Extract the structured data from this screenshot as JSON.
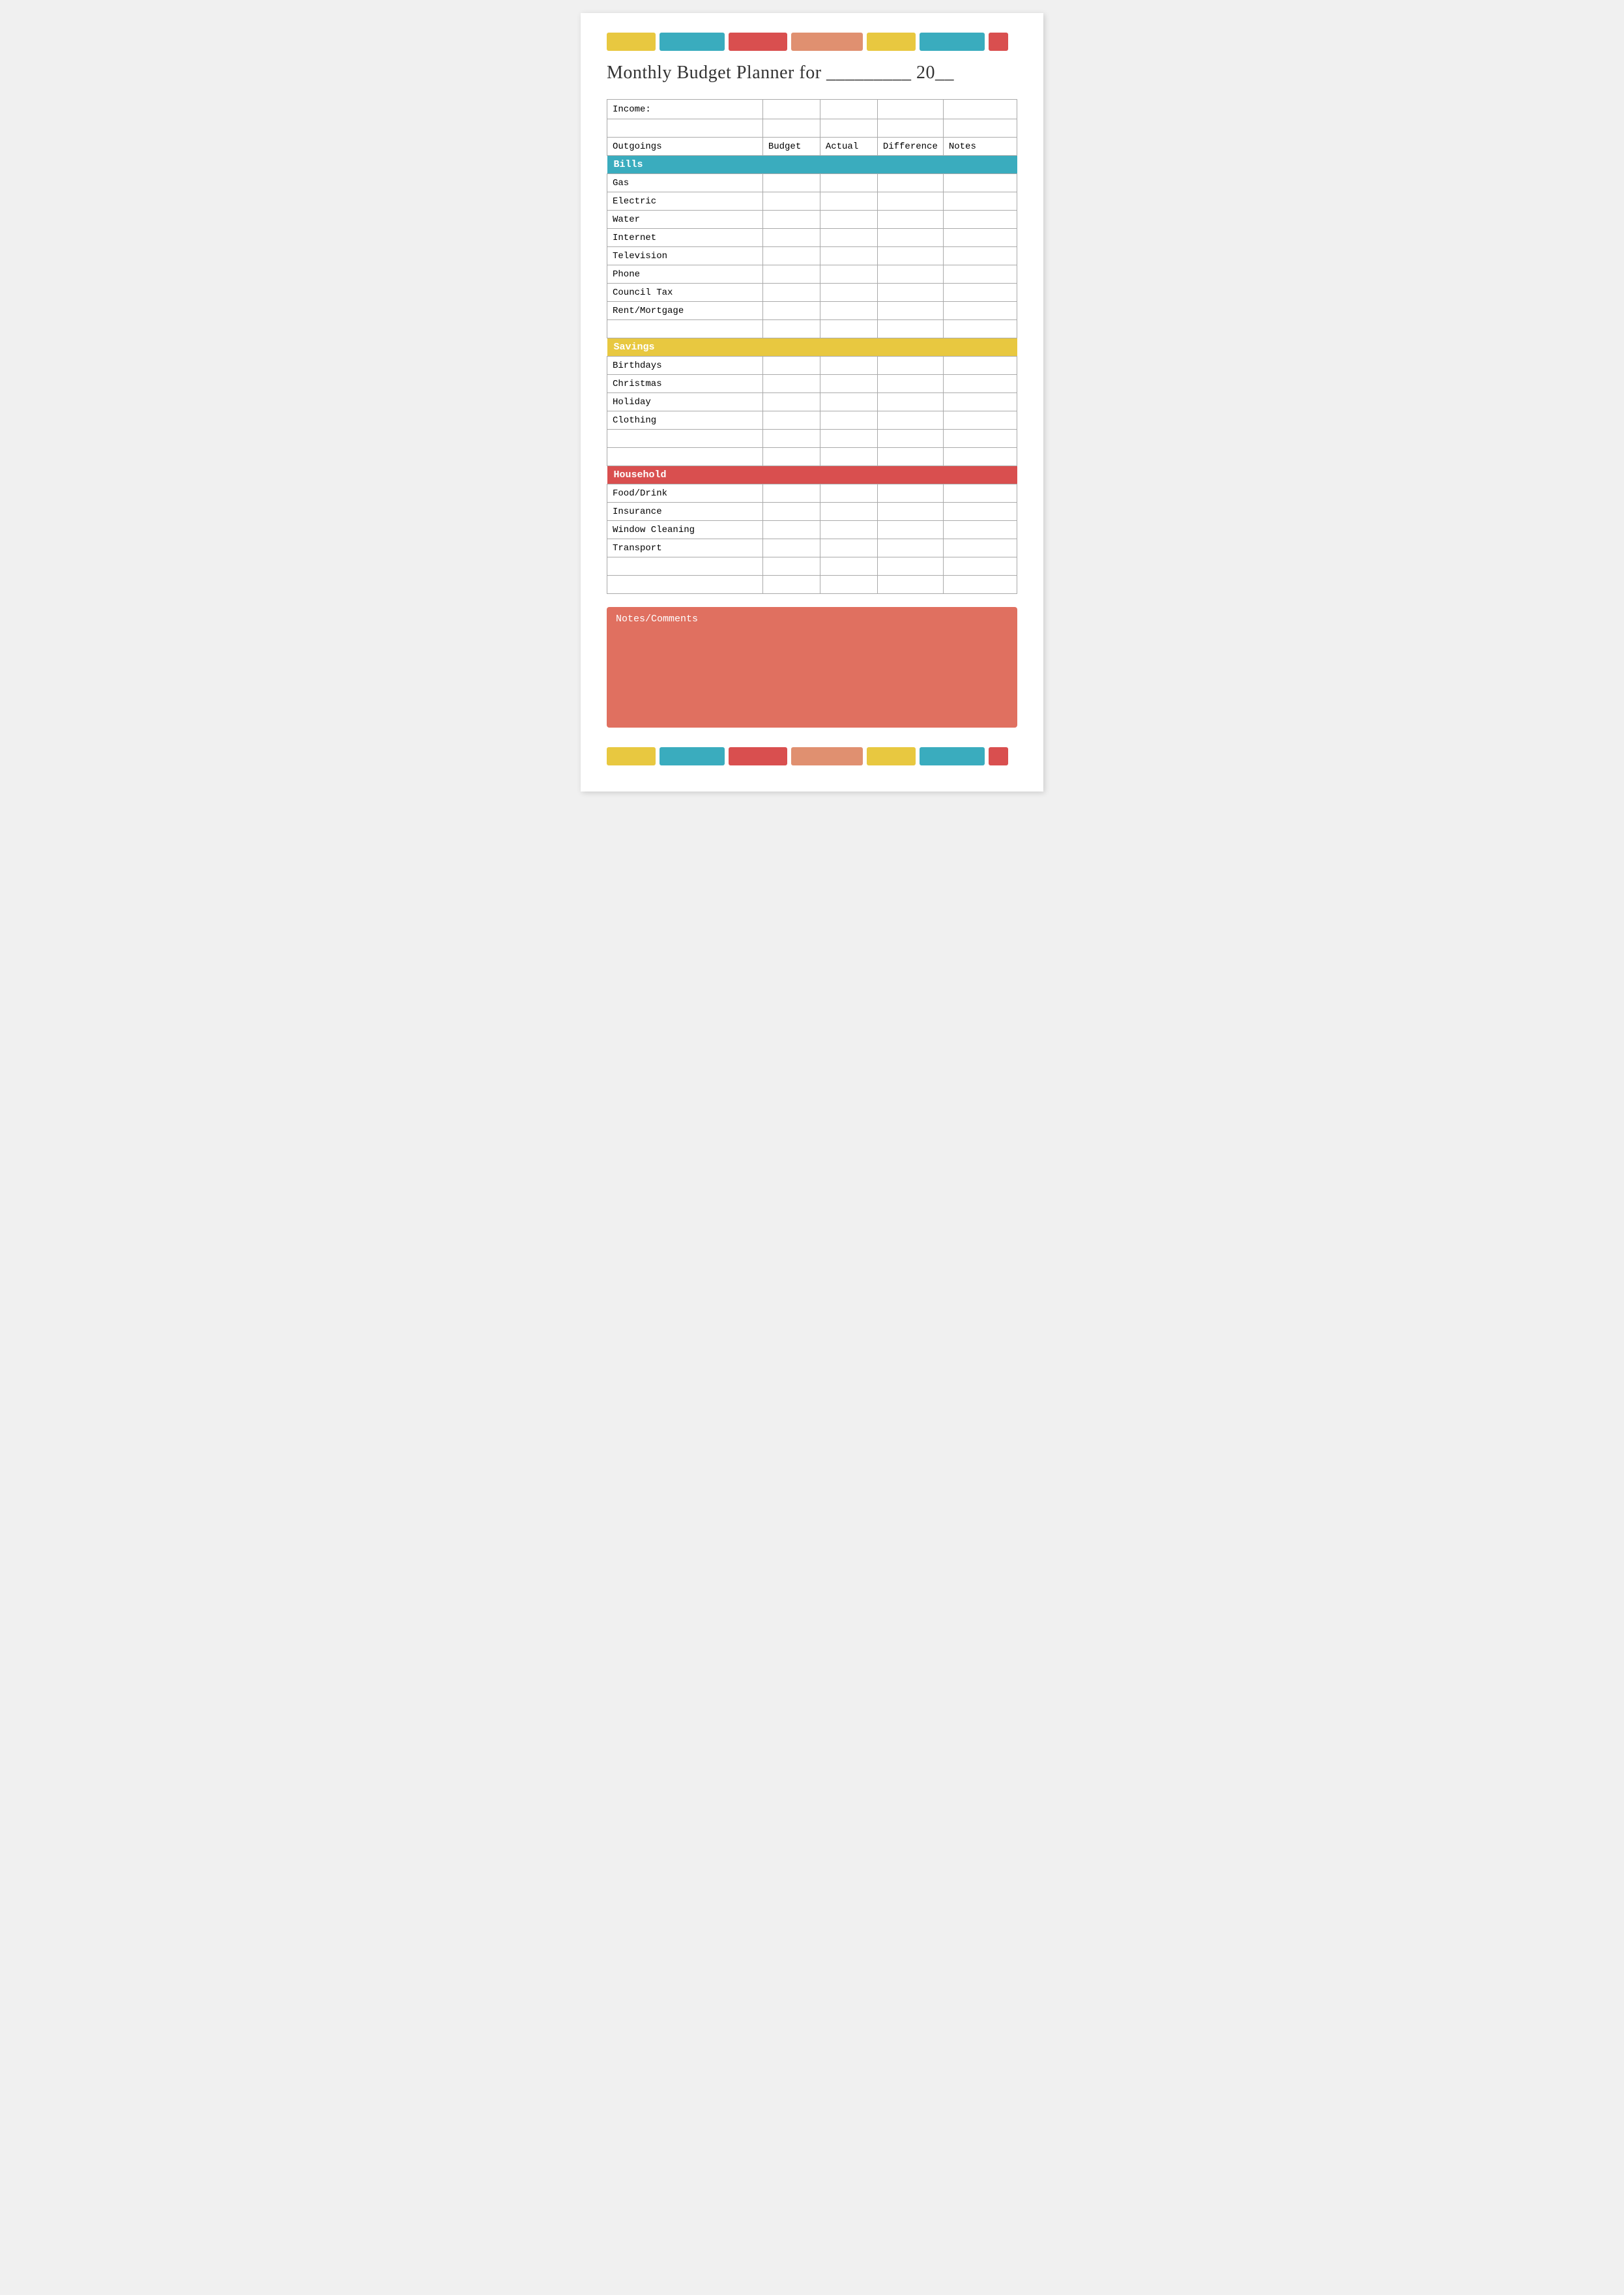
{
  "colors": {
    "yellow": "#E8C840",
    "teal": "#3AACBE",
    "red": "#D94F4F",
    "salmon": "#E09070",
    "notes_bg": "#E07060"
  },
  "color_bar": [
    {
      "name": "yellow",
      "width": 75,
      "color": "#E8C840"
    },
    {
      "name": "teal",
      "width": 100,
      "color": "#3AACBE"
    },
    {
      "name": "red",
      "width": 90,
      "color": "#D94F4F"
    },
    {
      "name": "salmon",
      "width": 110,
      "color": "#E09070"
    },
    {
      "name": "yellow2",
      "width": 75,
      "color": "#E8C840"
    },
    {
      "name": "teal2",
      "width": 100,
      "color": "#3AACBE"
    },
    {
      "name": "red2",
      "width": 30,
      "color": "#D94F4F"
    }
  ],
  "title": "Monthly Budget Planner for _________ 20__",
  "income_label": "Income:",
  "columns": {
    "outgoings": "Outgoings",
    "budget": "Budget",
    "actual": "Actual",
    "difference": "Difference",
    "notes": "Notes"
  },
  "sections": {
    "bills": {
      "label": "Bills",
      "items": [
        "Gas",
        "Electric",
        "Water",
        "Internet",
        "Television",
        "Phone",
        "Council Tax",
        "Rent/Mortgage"
      ]
    },
    "savings": {
      "label": "Savings",
      "items": [
        "Birthdays",
        "Christmas",
        "Holiday",
        "Clothing"
      ]
    },
    "household": {
      "label": "Household",
      "items": [
        "Food/Drink",
        "Insurance",
        "Window Cleaning",
        "Transport"
      ]
    }
  },
  "notes_section": {
    "label": "Notes/Comments"
  }
}
